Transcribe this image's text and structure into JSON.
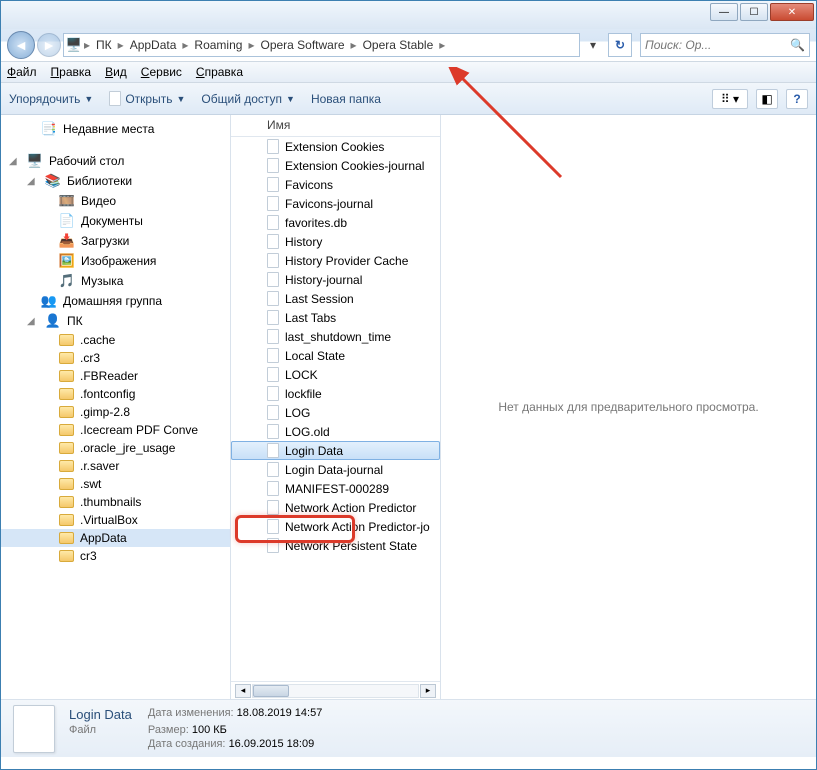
{
  "breadcrumb": [
    "ПК",
    "AppData",
    "Roaming",
    "Opera Software",
    "Opera Stable"
  ],
  "search_placeholder": "Поиск: Op...",
  "menu": {
    "file": "Файл",
    "edit": "Правка",
    "view": "Вид",
    "tools": "Сервис",
    "help": "Справка"
  },
  "toolbar": {
    "organize": "Упорядочить",
    "open": "Открыть",
    "share": "Общий доступ",
    "newfolder": "Новая папка"
  },
  "sidebar": [
    {
      "label": "Недавние места",
      "icon": "recent",
      "indent": 1
    },
    {
      "label": "",
      "spacer": true
    },
    {
      "label": "Рабочий стол",
      "icon": "desktop",
      "indent": 0,
      "exp": true
    },
    {
      "label": "Библиотеки",
      "icon": "library",
      "indent": 1,
      "exp": true
    },
    {
      "label": "Видео",
      "icon": "video",
      "indent": 2
    },
    {
      "label": "Документы",
      "icon": "doc",
      "indent": 2
    },
    {
      "label": "Загрузки",
      "icon": "down",
      "indent": 2
    },
    {
      "label": "Изображения",
      "icon": "img",
      "indent": 2
    },
    {
      "label": "Музыка",
      "icon": "music",
      "indent": 2
    },
    {
      "label": "Домашняя группа",
      "icon": "home",
      "indent": 1
    },
    {
      "label": "ПК",
      "icon": "user",
      "indent": 1,
      "exp": true
    },
    {
      "label": ".cache",
      "icon": "folder",
      "indent": 2
    },
    {
      "label": ".cr3",
      "icon": "folder",
      "indent": 2
    },
    {
      "label": ".FBReader",
      "icon": "folder",
      "indent": 2
    },
    {
      "label": ".fontconfig",
      "icon": "folder",
      "indent": 2
    },
    {
      "label": ".gimp-2.8",
      "icon": "folder",
      "indent": 2
    },
    {
      "label": ".Icecream PDF Conve",
      "icon": "folder",
      "indent": 2
    },
    {
      "label": ".oracle_jre_usage",
      "icon": "folder",
      "indent": 2
    },
    {
      "label": ".r.saver",
      "icon": "folder",
      "indent": 2
    },
    {
      "label": ".swt",
      "icon": "folder",
      "indent": 2
    },
    {
      "label": ".thumbnails",
      "icon": "folder",
      "indent": 2
    },
    {
      "label": ".VirtualBox",
      "icon": "folder",
      "indent": 2
    },
    {
      "label": "AppData",
      "icon": "folder",
      "indent": 2,
      "sel": true
    },
    {
      "label": "cr3",
      "icon": "folder",
      "indent": 2
    }
  ],
  "column_header": "Имя",
  "files": [
    "Extension Cookies",
    "Extension Cookies-journal",
    "Favicons",
    "Favicons-journal",
    "favorites.db",
    "History",
    "History Provider Cache",
    "History-journal",
    "Last Session",
    "Last Tabs",
    "last_shutdown_time",
    "Local State",
    "LOCK",
    "lockfile",
    "LOG",
    "LOG.old",
    "Login Data",
    "Login Data-journal",
    "MANIFEST-000289",
    "Network Action Predictor",
    "Network Action Predictor-jo",
    "Network Persistent State"
  ],
  "selected_index": 16,
  "preview_text": "Нет данных для предварительного просмотра.",
  "details": {
    "name": "Login Data",
    "type": "Файл",
    "mod_lbl": "Дата изменения:",
    "mod": "18.08.2019 14:57",
    "size_lbl": "Размер:",
    "size": "100 КБ",
    "created_lbl": "Дата создания:",
    "created": "16.09.2015 18:09"
  }
}
